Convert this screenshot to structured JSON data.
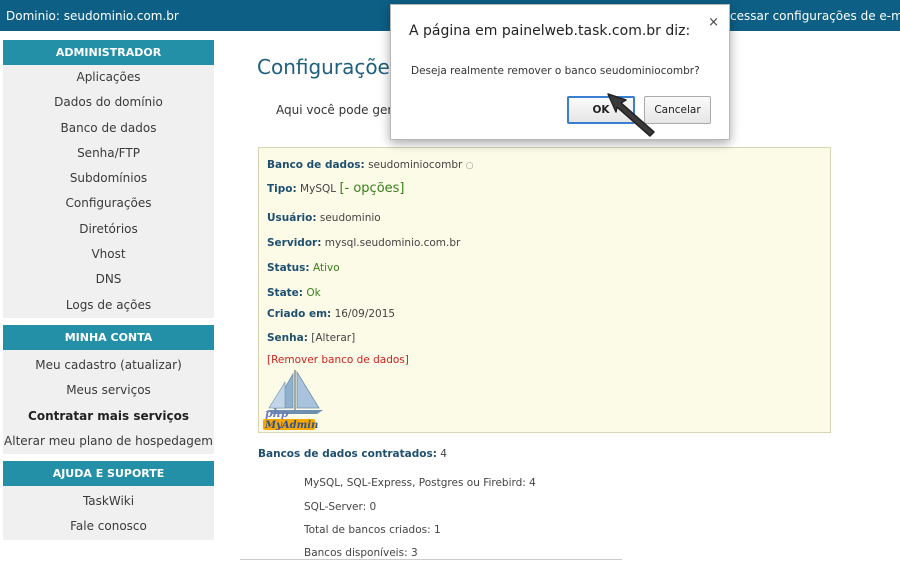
{
  "topbar": {
    "domain_text": "Dominio: seudominio.com.br",
    "email_link": "cessar configurações de e-mail"
  },
  "sidebar": {
    "admin": {
      "heading": "ADMINISTRADOR",
      "items": [
        "Aplicações",
        "Dados do domínio",
        "Banco de dados",
        "Senha/FTP",
        "Subdomínios",
        "Configurações",
        "Diretórios",
        "Vhost",
        "DNS",
        "Logs de ações"
      ]
    },
    "account": {
      "heading": "MINHA CONTA",
      "items": [
        "Meu cadastro (atualizar)",
        "Meus serviços",
        "Contratar mais serviços",
        "Alterar meu plano de hospedagem"
      ]
    },
    "support": {
      "heading": "AJUDA E SUPORTE",
      "items": [
        "TaskWiki",
        "Fale conosco"
      ]
    }
  },
  "main": {
    "title": "Configurações d",
    "intro": "Aqui você pode gerer",
    "db": {
      "db_label": "Banco de dados:",
      "db_value": "seudominiocombr",
      "tipo_label": "Tipo:",
      "tipo_value": "MySQL",
      "opcoes": "[- opções]",
      "usuario_label": "Usuário:",
      "usuario_value": "seudominio",
      "servidor_label": "Servidor:",
      "servidor_value": "mysql.seudominio.com.br",
      "status_label": "Status:",
      "status_value": "Ativo",
      "state_label": "State:",
      "state_value": "Ok",
      "criado_label": "Criado em:",
      "criado_value": "16/09/2015",
      "senha_label": "Senha:",
      "senha_link": "[Alterar]",
      "remove_link": "[Remover banco de dados]",
      "pma_php": "php",
      "pma_name": "MyAdmin"
    },
    "contracted": {
      "label": "Bancos de dados contratados:",
      "value": "4",
      "lines": [
        "MySQL, SQL-Express, Postgres ou Firebird: 4",
        "SQL-Server: 0",
        "Total de bancos criados: 1",
        "Bancos disponíveis: 3"
      ]
    }
  },
  "dialog": {
    "title": "A página em painelweb.task.com.br diz:",
    "close": "×",
    "message": "Deseja realmente remover o banco seudominiocombr?",
    "ok": "OK",
    "cancel": "Cancelar"
  }
}
